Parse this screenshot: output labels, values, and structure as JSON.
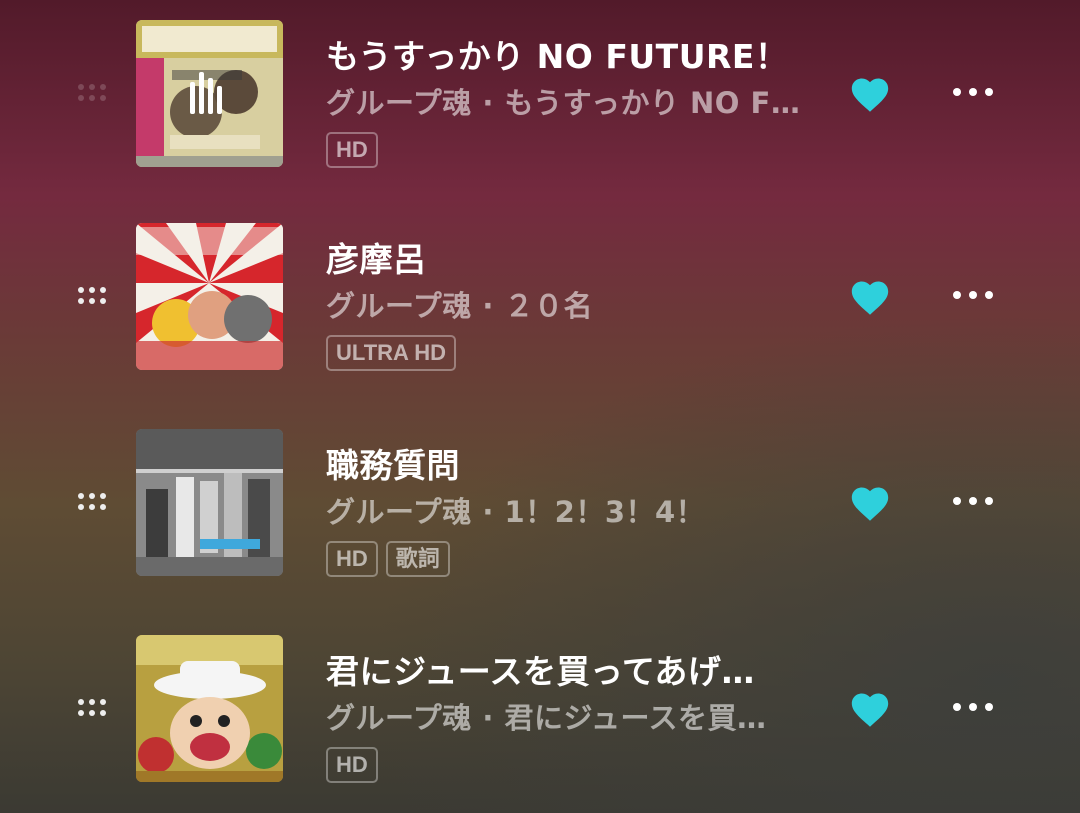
{
  "tracks": [
    {
      "title": "もうすっかり NO FUTURE！",
      "subtitle": "グループ魂 · もうすっかり NO F…",
      "badges": [
        "HD"
      ],
      "liked": true,
      "playing": true,
      "art_icon": "album-art-no-future"
    },
    {
      "title": "彦摩呂",
      "subtitle": "グループ魂 · ２０名",
      "badges": [
        "ULTRA HD"
      ],
      "liked": true,
      "playing": false,
      "art_icon": "album-art-20mei"
    },
    {
      "title": "職務質問",
      "subtitle": "グループ魂 · 1！2！3！4！",
      "badges": [
        "HD",
        "歌詞"
      ],
      "liked": true,
      "playing": false,
      "art_icon": "album-art-1234"
    },
    {
      "title": "君にジュースを買ってあげ…",
      "subtitle": "グループ魂 · 君にジュースを買…",
      "badges": [
        "HD"
      ],
      "liked": true,
      "playing": false,
      "art_icon": "album-art-juice"
    }
  ],
  "colors": {
    "heart": "#2ed0dc",
    "text_primary": "#ffffff",
    "text_secondary": "rgba(255,255,255,0.56)"
  }
}
